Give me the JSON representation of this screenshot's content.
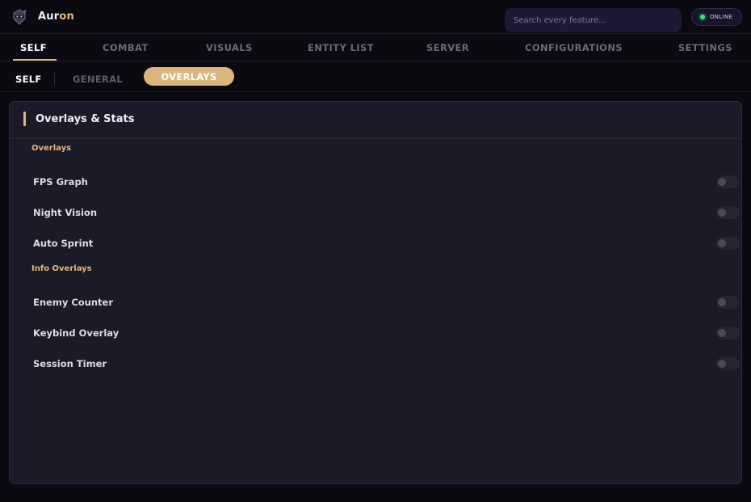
{
  "app": {
    "brand_part1": "Aur",
    "brand_part2": "on",
    "logo_icon": "ninja-mask-icon",
    "accent_color": "#e3b777"
  },
  "search": {
    "placeholder": "Search every feature..."
  },
  "status": {
    "label": "ONLINE",
    "color": "#3fe07a"
  },
  "tabs": [
    {
      "label": "SELF",
      "active": true
    },
    {
      "label": "COMBAT",
      "active": false
    },
    {
      "label": "VISUALS",
      "active": false
    },
    {
      "label": "ENTITY LIST",
      "active": false
    },
    {
      "label": "SERVER",
      "active": false
    },
    {
      "label": "CONFIGURATIONS",
      "active": false
    },
    {
      "label": "SETTINGS",
      "active": false
    }
  ],
  "subtabs": {
    "current": "SELF",
    "items": [
      {
        "label": "GENERAL",
        "active": false
      },
      {
        "label": "OVERLAYS",
        "active": true
      }
    ]
  },
  "panel": {
    "title": "Overlays & Stats",
    "sections": [
      {
        "label": "Overlays",
        "rows": [
          {
            "label": "FPS Graph",
            "enabled": false
          },
          {
            "label": "Night Vision",
            "enabled": false
          },
          {
            "label": "Auto Sprint",
            "enabled": false
          }
        ]
      },
      {
        "label": "Info Overlays",
        "rows": [
          {
            "label": "Enemy Counter",
            "enabled": false
          },
          {
            "label": "Keybind Overlay",
            "enabled": false
          },
          {
            "label": "Session Timer",
            "enabled": false
          }
        ]
      }
    ]
  }
}
